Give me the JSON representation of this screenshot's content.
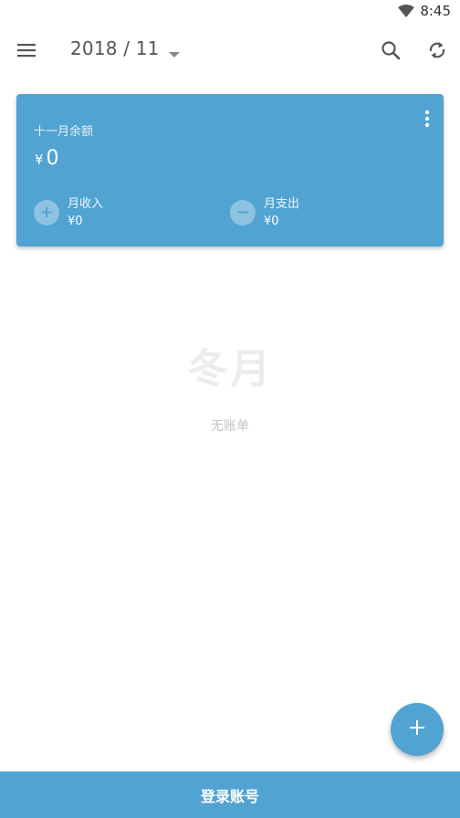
{
  "status_bar": {
    "time": "8:45",
    "wifi_icon": "wifi-icon"
  },
  "toolbar": {
    "menu_icon": "menu-icon",
    "month": "2018 / 11",
    "dropdown_icon": "dropdown-icon",
    "search_icon": "search-icon",
    "sync_icon": "sync-icon"
  },
  "summary": {
    "balance_label": "十一月余额",
    "currency": "¥",
    "balance": "0",
    "more_icon": "more-vert-icon",
    "income": {
      "label": "月收入",
      "amount": "¥0",
      "icon_symbol": "+"
    },
    "expense": {
      "label": "月支出",
      "amount": "¥0",
      "icon_symbol": "−"
    }
  },
  "empty_state": {
    "title": "冬月",
    "subtitle": "无账单"
  },
  "fab": {
    "icon": "add-icon"
  },
  "login": {
    "label": "登录账号"
  },
  "colors": {
    "primary": "#51a3d1",
    "background": "#ffffff",
    "empty_title": "#ececec",
    "empty_subtitle": "#c4c4c4"
  }
}
